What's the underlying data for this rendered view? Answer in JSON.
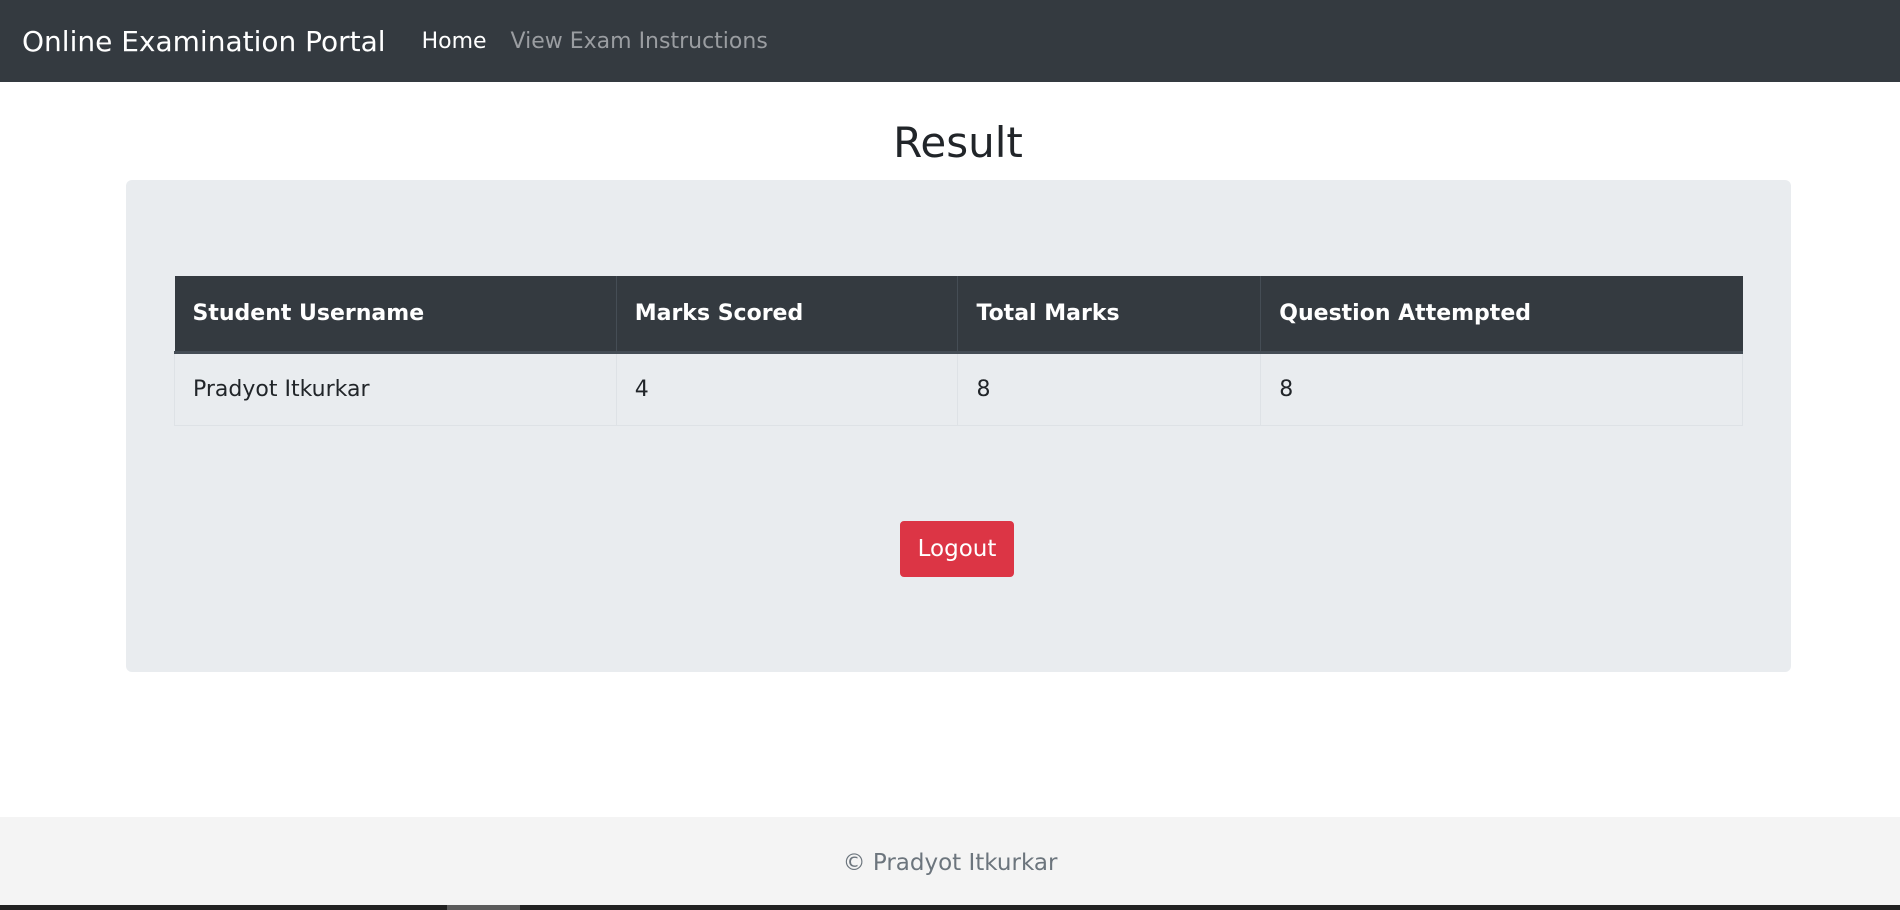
{
  "navbar": {
    "brand": "Online Examination Portal",
    "links": [
      {
        "label": "Home",
        "active": true
      },
      {
        "label": "View Exam Instructions",
        "active": false
      }
    ]
  },
  "page": {
    "title": "Result"
  },
  "result_table": {
    "headers": [
      "Student Username",
      "Marks Scored",
      "Total Marks",
      "Question Attempted"
    ],
    "rows": [
      [
        "Pradyot Itkurkar",
        "4",
        "8",
        "8"
      ]
    ]
  },
  "actions": {
    "logout_label": "Logout"
  },
  "footer": {
    "text": "© Pradyot Itkurkar"
  },
  "colors": {
    "navbar_bg": "#343a40",
    "jumbotron_bg": "#e9ecef",
    "danger": "#dc3545",
    "footer_bg": "#f4f4f4"
  }
}
